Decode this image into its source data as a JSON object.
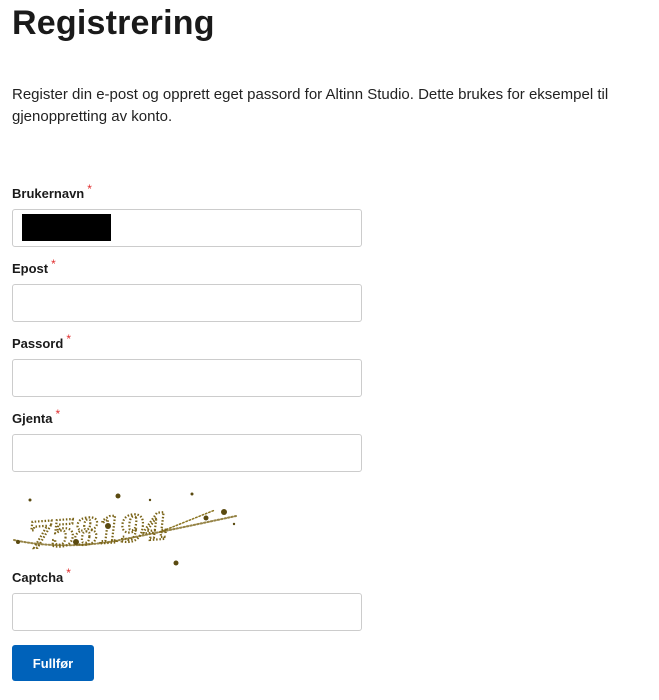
{
  "page": {
    "title": "Registrering",
    "intro": "Register din e-post og opprett eget passord for Altinn Studio. Dette brukes for eksempel til gjenoppretting av konto."
  },
  "form": {
    "required_mark": "*",
    "username": {
      "label": "Brukernavn",
      "value": ""
    },
    "email": {
      "label": "Epost",
      "value": ""
    },
    "password": {
      "label": "Passord",
      "value": ""
    },
    "repeat": {
      "label": "Gjenta",
      "value": ""
    },
    "captcha": {
      "label": "Captcha",
      "value": "",
      "image_text": "758194"
    },
    "submit_label": "Fullfør"
  },
  "colors": {
    "primary": "#0062ba",
    "required": "#e02e2e",
    "captcha_ink": "#7a6418"
  }
}
